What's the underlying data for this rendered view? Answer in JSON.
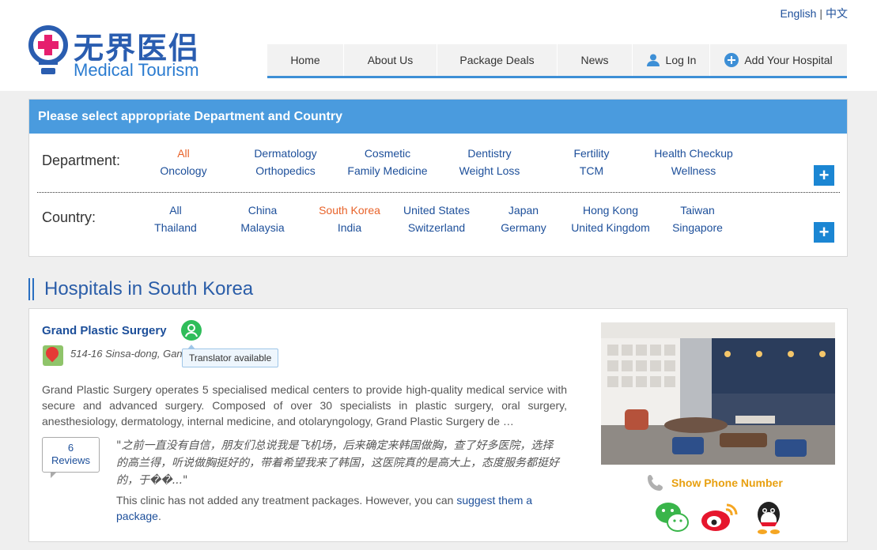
{
  "lang": {
    "english": "English",
    "chinese": "中文"
  },
  "logo": {
    "cn": "无界医侣",
    "en": "Medical Tourism"
  },
  "nav": [
    {
      "label": "Home"
    },
    {
      "label": "About Us"
    },
    {
      "label": "Package Deals"
    },
    {
      "label": "News"
    },
    {
      "label": "Log In",
      "icon": "user-icon"
    },
    {
      "label": "Add Your Hospital",
      "icon": "plus-circle-icon"
    }
  ],
  "filter": {
    "header": "Please select appropriate Department and Country",
    "department_label": "Department:",
    "country_label": "Country:",
    "departments": [
      "All",
      "Dermatology",
      "Cosmetic",
      "Dentistry",
      "Fertility",
      "Health Checkup",
      "Oncology",
      "Orthopedics",
      "Family Medicine",
      "Weight Loss",
      "TCM",
      "Wellness"
    ],
    "countries": [
      "All",
      "China",
      "South Korea",
      "United States",
      "Japan",
      "Hong Kong",
      "Taiwan",
      "Thailand",
      "Malaysia",
      "India",
      "Switzerland",
      "Germany",
      "United Kingdom",
      "Singapore"
    ],
    "active_department": "All",
    "active_country": "South Korea",
    "more_button": "+"
  },
  "section_title": "Hospitals in South Korea",
  "hospital": {
    "name": "Grand Plastic Surgery",
    "translator_tooltip": "Translator available",
    "address": "514-16 Sinsa-dong, Gan",
    "description": "Grand Plastic Surgery operates 5 specialised medical centers to provide high-quality medical service with secure and advanced surgery. Composed of over 30 specialists in plastic surgery, oral surgery, anesthesiology, dermatology, internal medicine, and otolaryngology, Grand Plastic Surgery de …",
    "reviews_count": "6",
    "reviews_label": "Reviews",
    "review_quote": "\"之前一直没有自信，朋友们总说我是飞机场，后来确定来韩国做胸，查了好多医院，选择的高兰得，听说做胸挺好的，带着希望我来了韩国，这医院真的是高大上，态度服务都挺好的，于��...\"",
    "no_packages_text": "This clinic has not added any treatment packages. However, you can",
    "suggest_link": "suggest them a package",
    "no_packages_end": ".",
    "phone_label": "Show Phone Number",
    "social": [
      "wechat-icon",
      "weibo-icon",
      "qq-icon"
    ]
  },
  "colors": {
    "accent": "#4a9bde",
    "link": "#1d4f9a",
    "active": "#e8632a",
    "phone": "#e8a010"
  }
}
